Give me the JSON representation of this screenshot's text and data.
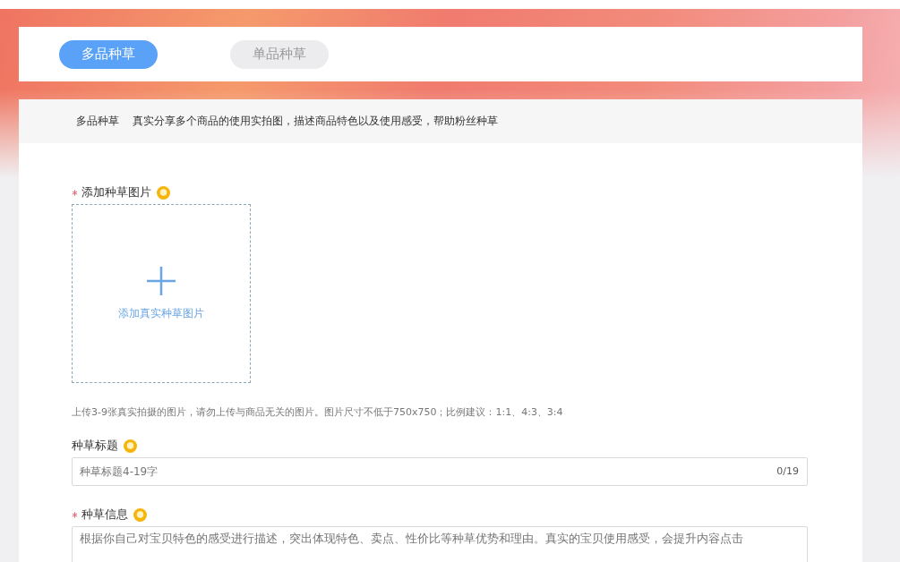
{
  "tabs": [
    {
      "label": "多品种草",
      "selected": true
    },
    {
      "label": "单品种草",
      "selected": false
    }
  ],
  "intro": {
    "title": "多品种草",
    "text": "真实分享多个商品的使用实拍图，描述商品特色以及使用感受，帮助粉丝种草"
  },
  "form": [
    {
      "kind": "upload",
      "label": "添加种草图片",
      "required": true,
      "button": "添加真实种草图片",
      "hint": "上传3-9张真实拍摄的图片，请勿上传与商品无关的图片。图片尺寸不低于750x750；比例建议：1:1、4:3、3:4"
    },
    {
      "kind": "input",
      "label": "种草标题",
      "required": false,
      "placeholder": "种草标题4-19字",
      "counter": "0/19"
    },
    {
      "kind": "textarea",
      "label": "种草信息",
      "required": true,
      "placeholder": "根据你自己对宝贝特色的感受进行描述，突出体现特色、卖点、性价比等种草优势和理由。真实的宝贝使用感受，会提升内容点击"
    }
  ]
}
